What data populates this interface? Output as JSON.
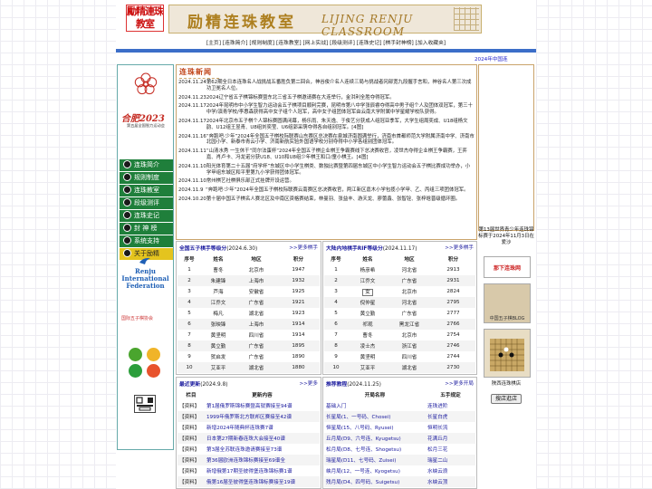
{
  "header": {
    "logo_text": "勵精連珠教室",
    "title_cn": "励精连珠教室",
    "title_en": "LIJING RENJU CLASSROOM"
  },
  "nav": {
    "items": [
      "主页",
      "连珠简介",
      "规则制度",
      "连珠教室",
      "网上实战",
      "段级测评",
      "连珠史记",
      "棋手封神榜",
      "加入收藏夹"
    ]
  },
  "marquee": "2024年中国连",
  "left": {
    "city": "合肥2023",
    "event": "第五届全国智力运动会",
    "menu": [
      "连珠简介",
      "规则制度",
      "连珠教室",
      "段级测评",
      "连珠史记",
      "封 神 榜",
      "系统支持",
      "关于励精"
    ],
    "rif": [
      "Renju",
      "International",
      "Federation"
    ],
    "assoc": "国际五子棋协会"
  },
  "news": {
    "heading": "连珠新闻",
    "items": [
      {
        "date": "2024.11.24",
        "text": "第62期全日本连珠名人战挑战五番胜负第二回合，神谷俊介名人连续三局与挑战者冈部宽九段握手言和，神谷名人第三次成功卫冕名人位。"
      },
      {
        "date": "2024.11.23",
        "text": "2024辽宁省五子棋锦标赛暨东北三省五子棋邀请赛在大连举行，金洪利全胜夺得冠军。"
      },
      {
        "date": "2024.11.17",
        "text": "2024年昆明市中小学生智力运动会五子棋项目顺利完赛，昆明市第八中学张辰睿夺得高中男子组个人及团体双冠军，第三十中学/滇青学校/李惠森获得高中女子组个人冠军，高中女子组团体冠军由云南大学附属中学星耀学校队获得。"
      },
      {
        "date": "2024.11.17",
        "text": "2024年北京市五子棋个人锦标赛圆满闭幕，杨乐雨、朱天逸、于俊艺分获成人组冠亚季军，大学生组周奕成、U18组杨文韵、U12组王昱青、U8组刘奕莹、U6组郭采萌夺得各自组别冠军。[4图]"
      },
      {
        "date": "2024.11.16",
        "text": "“奔跑吧·少年”2024年全国五子棋校际联赛山东赛区总决赛在泉城济南圆满举行，济南市首都师范大学附属济南中学、济南市北园小学、新泰市青云小学、济南新航实验外国语学校分别夺得中小学各组别团体冠军。"
      },
      {
        "date": "2024.11.11",
        "text": "“山清水秀 一生休干”同尔法蛋杯“2024年全国五子棋企业棋王争霸赛线下总决赛收官，凌世杰夺得企业棋王争霸赛，王弈嘉、肖卢卡、冯龙诺分获U18、U10和U8组少年棋王和口/童小棋王。[4图]"
      },
      {
        "date": "2024.11.10",
        "text": "阳光体育第二十五届“府学杯”东城区中小学生棋类、数独比赛暨第四届东城区中小学生智力运动会五子棋比赛成功举办，小学甲组东城区和平里第九小学获得团体冠军。"
      },
      {
        "date": "2024.11.10",
        "text": "常州棋艺社棋俱乐部正式挂牌开设运营。"
      },
      {
        "date": "2024.11.9",
        "text": "“奔跑吧·少年”2024年全国五子棋校际联赛云南赛区总决赛收官，两江新区嘉木小学包揽小学甲、乙、丙组三项团体冠军。"
      },
      {
        "date": "2024.10.20",
        "text": "第十届中国五子棋名人赛北区及中南区资格赛结束，林曼羽、张益丰、游天龙、廖蕾鑫、张智铨、张梓晗晋级循环圈。"
      }
    ]
  },
  "women_rank": {
    "title": "全国五子棋手等级分",
    "date": "(2024.6.30)",
    "more": ">>更多棋手",
    "headers": [
      "序号",
      "姓名",
      "地区",
      "积分"
    ],
    "selected": "女",
    "rows": [
      [
        "1",
        "曹冬",
        "北京市",
        "1947"
      ],
      [
        "2",
        "朱建锋",
        "上海市",
        "1932"
      ],
      [
        "3",
        "芦海",
        "安徽省",
        "1925"
      ],
      [
        "4",
        "江乔文",
        "广东省",
        "1921"
      ],
      [
        "5",
        "梅凡",
        "湖北省",
        "1923"
      ],
      [
        "6",
        "张映锋",
        "上海市",
        "1914"
      ],
      [
        "7",
        "黄坚明",
        "四川省",
        "1914"
      ],
      [
        "8",
        "黄立勤",
        "广东省",
        "1895"
      ],
      [
        "9",
        "贺启发",
        "广东省",
        "1890"
      ],
      [
        "10",
        "艾亚平",
        "湖北省",
        "1880"
      ]
    ]
  },
  "men_rank": {
    "title": "大陆内地棋手RIF等级分",
    "date": "(2024.11.17)",
    "more": ">>更多棋手",
    "headers": [
      "序号",
      "姓名",
      "地区",
      "积分"
    ],
    "rows": [
      [
        "1",
        "杨彦希",
        "河北省",
        "2913"
      ],
      [
        "2",
        "江乔文",
        "广东省",
        "2931"
      ],
      [
        "3",
        "女",
        "北京市",
        "2824"
      ],
      [
        "4",
        "倪仲星",
        "河北省",
        "2795"
      ],
      [
        "5",
        "黄立勤",
        "广东省",
        "2777"
      ],
      [
        "6",
        "祁观",
        "黑龙江省",
        "2766"
      ],
      [
        "7",
        "曹冬",
        "北京市",
        "2754"
      ],
      [
        "8",
        "凌士杰",
        "浙江省",
        "2746"
      ],
      [
        "9",
        "黄坚明",
        "四川省",
        "2744"
      ],
      [
        "10",
        "艾亚平",
        "湖北省",
        "2730"
      ]
    ]
  },
  "updates": {
    "title": "最近更新",
    "date": "(2024.9.8)",
    "more": ">>更多",
    "headers": [
      "栏目",
      "更新内容"
    ],
    "rows": [
      [
        "【资料】",
        "第1届俄罗斯锦标赛暨高就赛接至94谱"
      ],
      [
        "【资料】",
        "1999年俄罗斯北方联邦区赛接至42谱"
      ],
      [
        "【资料】",
        "新增2024年随典杯连珠赛7谱"
      ],
      [
        "【资料】",
        "日本第27期新春连珠大会接至40谱"
      ],
      [
        "【资料】",
        "第3届全苏联连珠邀请赛接至73谱"
      ],
      [
        "【资料】",
        "第36届欧洲连珠锦标赛接至69谱全"
      ],
      [
        "【资料】",
        "新增俄第17期圣彼得堡连珠锦标赛1谱"
      ],
      [
        "【资料】",
        "俄第16届圣彼得堡连珠锦标赛接至19谱"
      ]
    ]
  },
  "openings": {
    "title": "推荐教程",
    "date": "(2024.11.25)",
    "more": ">>更多开局",
    "headers": [
      "开局名称",
      "五手规定"
    ],
    "rows": [
      [
        "基础入门",
        "连珠进阶"
      ],
      [
        "长星局(1、一号码、Chosei)",
        "长星白虎"
      ],
      [
        "恒星局(15、八号码、Ryusei)",
        "恒明长流"
      ],
      [
        "丘月局(D9、六号连、Kyugetsu)",
        "花满丘月"
      ],
      [
        "松月局(D8、七号连、Shogetsu)",
        "松月三花"
      ],
      [
        "瑞星局(D11、七号码、Zuisei)",
        "瑞星二山"
      ],
      [
        "峡月局(12、一号连、Kyogetsu)",
        "水峡云浪"
      ],
      [
        "残月局(D4、四号码、Suigetsu)",
        "水峡云顶"
      ]
    ]
  },
  "right": {
    "event_text": "第13届世界青少年连珠锦标赛于2024年11月3日在爱沙",
    "banner1": "那下连珠网",
    "banner2": "中国五子棋BLOG",
    "caption": "陕西连珠棋店",
    "search": "搜店逛店"
  },
  "colors": {
    "menu_green": "#1f7f3b",
    "menu_yellow": "#e4c41e",
    "nav_blue": "#3c6ec8",
    "link_blue": "#1b1b9e",
    "news_heading": "#c1451a"
  }
}
